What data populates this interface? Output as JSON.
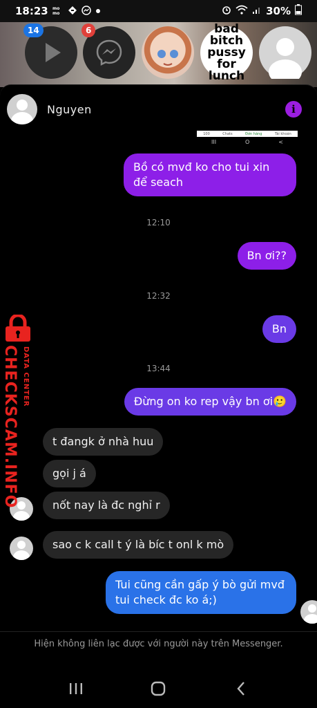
{
  "status_bar": {
    "time": "18:23",
    "battery": "30%",
    "left_icons": [
      "momo-icon",
      "data-saver-icon",
      "messenger-icon",
      "dot-icon"
    ],
    "right_icons": [
      "alarm-icon",
      "wifi-icon",
      "signal-icon",
      "battery-icon"
    ]
  },
  "chat_heads": [
    {
      "name": "video-head",
      "badge": "14"
    },
    {
      "name": "messenger-head",
      "badge": "6"
    },
    {
      "name": "anime-head",
      "badge": ""
    },
    {
      "name": "text-head",
      "text": "bad bitch pussy for lunch"
    },
    {
      "name": "default-head",
      "badge": ""
    }
  ],
  "header": {
    "contact_name": "Nguyen",
    "info_icon": "i"
  },
  "thumbnail": {
    "tabs": [
      "100",
      "Chats",
      "Đơn hàng",
      "Tài khoản"
    ],
    "nav": [
      "III",
      "O",
      "<"
    ]
  },
  "messages": [
    {
      "type": "out",
      "text": "Bồ có mvđ ko cho tui xin để seach"
    },
    {
      "type": "timestamp",
      "text": "12:10"
    },
    {
      "type": "out",
      "text": "Bn ơi??"
    },
    {
      "type": "timestamp",
      "text": "12:32"
    },
    {
      "type": "out",
      "text": "Bn"
    },
    {
      "type": "timestamp",
      "text": "13:44"
    },
    {
      "type": "out",
      "text": "Đừng on ko rep vậy bn ơi🥲"
    },
    {
      "type": "in",
      "text": "t đangk ở nhà huu"
    },
    {
      "type": "in",
      "text": "gọi j á"
    },
    {
      "type": "in",
      "text": "nốt nay là đc nghỉ r"
    },
    {
      "type": "in",
      "text": "sao c k call t ý là bíc t onl k mò"
    },
    {
      "type": "out",
      "text": "Tui cũng cần gấp ý bò gửi mvđ tui check đc ko á;)"
    }
  ],
  "footer_note": "Hiện không liên lạc được với người này trên Messenger.",
  "watermark": {
    "big": "CHECKSCAM.INFO",
    "small": "DATA CENTER"
  },
  "nav_bar": [
    "recents-icon",
    "home-icon",
    "back-icon"
  ],
  "colors": {
    "purple": "#8d1fe8",
    "violet": "#6a3ae6",
    "blue": "#2a72e8",
    "incoming": "#262626",
    "watermark_red": "#e8231f"
  }
}
